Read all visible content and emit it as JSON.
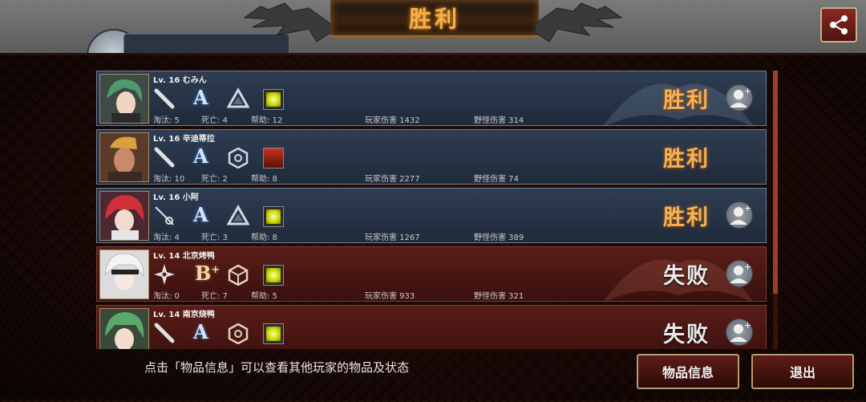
{
  "header": {
    "title": "胜利",
    "top_tab_label": "..."
  },
  "players": [
    {
      "name": "Lv. 16 むみん",
      "grade": "A",
      "item": "yellow",
      "kills_label": "淘汰: 5",
      "deaths_label": "死亡: 4",
      "assists_label": "帮助: 12",
      "player_dmg_label": "玩家伤害 1432",
      "monster_dmg_label": "野怪伤害 314",
      "result": "胜利",
      "team": "win"
    },
    {
      "name": "Lv. 16 辛迪蒂拉",
      "grade": "A",
      "item": "red",
      "kills_label": "淘汰: 10",
      "deaths_label": "死亡: 2",
      "assists_label": "帮助: 8",
      "player_dmg_label": "玩家伤害 2277",
      "monster_dmg_label": "野怪伤害 74",
      "result": "胜利",
      "team": "win"
    },
    {
      "name": "Lv. 16 小阿",
      "grade": "A",
      "item": "yellow",
      "kills_label": "淘汰: 4",
      "deaths_label": "死亡: 3",
      "assists_label": "帮助: 8",
      "player_dmg_label": "玩家伤害 1267",
      "monster_dmg_label": "野怪伤害 389",
      "result": "胜利",
      "team": "win"
    },
    {
      "name": "Lv. 14 北京烤鸭",
      "grade": "B",
      "item": "yellow",
      "kills_label": "淘汰: 0",
      "deaths_label": "死亡: 7",
      "assists_label": "帮助: 5",
      "player_dmg_label": "玩家伤害 933",
      "monster_dmg_label": "野怪伤害 321",
      "result": "失败",
      "team": "loss"
    },
    {
      "name": "Lv. 14 南京烧鸭",
      "grade": "A",
      "item": "yellow",
      "kills_label": "",
      "deaths_label": "",
      "assists_label": "",
      "player_dmg_label": "",
      "monster_dmg_label": "",
      "result": "失败",
      "team": "loss"
    }
  ],
  "footer": {
    "hint": "点击「物品信息」可以查看其他玩家的物品及状态",
    "info_button": "物品信息",
    "exit_button": "退出"
  },
  "colors": {
    "win_row": "#2f3d52",
    "loss_row": "#5a1d18",
    "accent": "#f2b24a"
  },
  "icons": {
    "share": "share-icon",
    "add_friend": "add-friend-icon"
  }
}
